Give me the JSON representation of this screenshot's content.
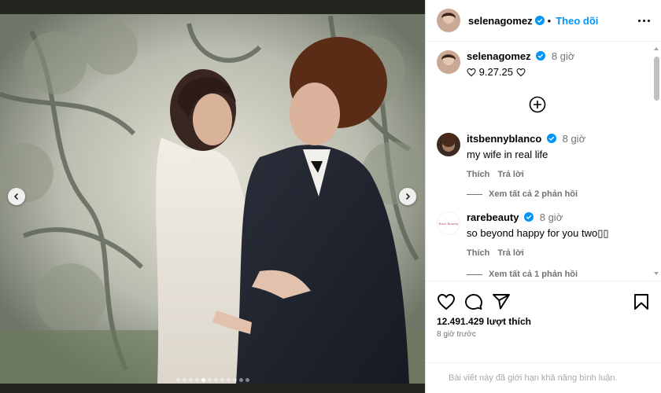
{
  "post": {
    "author": "selenagomez",
    "follow_label": "Theo dõi",
    "separator": "•",
    "caption": {
      "username": "selenagomez",
      "time": "8 giờ",
      "text": "9.27.25"
    },
    "carousel": {
      "total_slides": 12,
      "active_index": 4
    }
  },
  "comments": [
    {
      "username": "itsbennyblanco",
      "verified": true,
      "time": "8 giờ",
      "text": "my wife in real life",
      "like_label": "Thích",
      "reply_label": "Trả lời",
      "view_replies": "Xem tất cả 2 phản hồi"
    },
    {
      "username": "rarebeauty",
      "verified": true,
      "time": "8 giờ",
      "text": "so beyond happy for you two▯▯",
      "like_label": "Thích",
      "reply_label": "Trả lời",
      "view_replies": "Xem tất cả 1 phản hồi",
      "avatar_text": "Rare Beauty"
    }
  ],
  "actions": {
    "icons": [
      "heart-icon",
      "comment-icon",
      "share-icon",
      "bookmark-icon"
    ],
    "likes": "12.491.429 lượt thích",
    "posted_ago": "8 giờ trước",
    "comments_limited": "Bài viết này đã giới hạn khả năng bình luận."
  },
  "colors": {
    "accent": "#0095f6",
    "muted": "#737373",
    "verified": "#0095f6"
  }
}
